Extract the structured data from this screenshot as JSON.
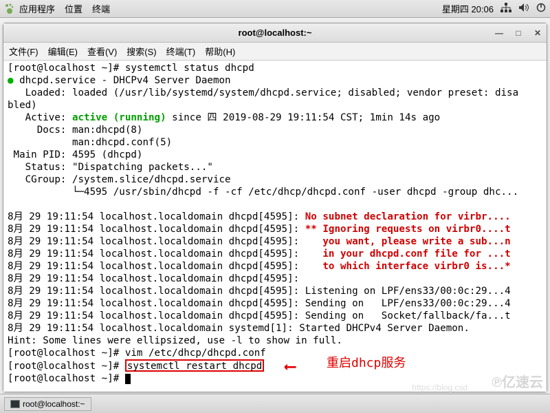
{
  "topbar": {
    "apps": "应用程序",
    "places": "位置",
    "terminal": "终端",
    "clock": "星期四 20:06"
  },
  "window": {
    "title": "root@localhost:~",
    "menu": {
      "file": "文件(F)",
      "edit": "编辑(E)",
      "view": "查看(V)",
      "search": "搜索(S)",
      "terminal": "终端(T)",
      "help": "帮助(H)"
    }
  },
  "term": {
    "prompt": "[root@localhost ~]# ",
    "cmd1": "systemctl status dhcpd",
    "svc_line": "dhcpd.service - DHCPv4 Server Daemon",
    "loaded": "   Loaded: loaded (/usr/lib/systemd/system/dhcpd.service; disabled; vendor preset: disa\nbled)",
    "active_label": "   Active: ",
    "active_val": "active (running)",
    "active_rest": " since 四 2019-08-29 19:11:54 CST; 1min 14s ago",
    "docs": "     Docs: man:dhcpd(8)\n           man:dhcpd.conf(5)",
    "mainpid": " Main PID: 4595 (dhcpd)",
    "status": "   Status: \"Dispatching packets...\"",
    "cgroup": "   CGroup: /system.slice/dhcpd.service\n           └─4595 /usr/sbin/dhcpd -f -cf /etc/dhcp/dhcpd.conf -user dhcpd -group dhc...",
    "log_prefix": "8月 29 19:11:54 localhost.localdomain dhcpd[4595]: ",
    "sys_prefix": "8月 29 19:11:54 localhost.localdomain systemd[1]: ",
    "w1": "No subnet declaration for virbr....",
    "w2": "** Ignoring requests on virbr0....t",
    "w3": "   you want, please write a sub...n",
    "w4": "   in your dhcpd.conf file for ...t",
    "w5": "   to which interface virbr0 is...*",
    "l1": "",
    "l2": "Listening on LPF/ens33/00:0c:29...4",
    "l3": "Sending on   LPF/ens33/00:0c:29...4",
    "l4": "Sending on   Socket/fallback/fa...t",
    "l5": "Started DHCPv4 Server Daemon.",
    "hint": "Hint: Some lines were ellipsized, use -l to show in full.",
    "cmd2": "vim /etc/dhcp/dhcpd.conf",
    "cmd3": "systemctl restart dhcpd",
    "annotation": "重启dhcp服务"
  },
  "taskbar": {
    "task1": "root@localhost:~"
  },
  "watermark": {
    "brand": "亿速云",
    "url": "https://blog.csd"
  }
}
